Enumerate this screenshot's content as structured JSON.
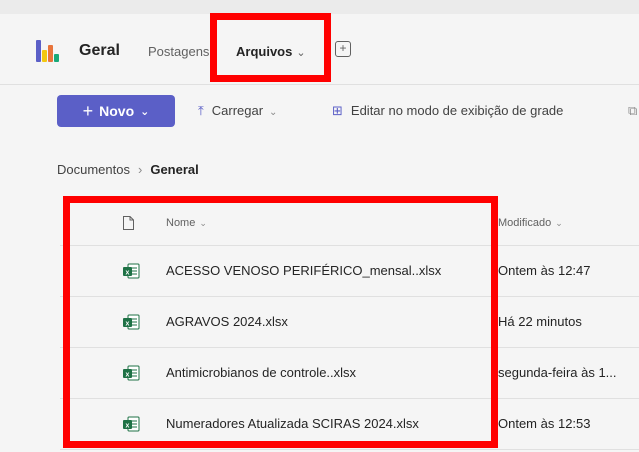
{
  "header": {
    "channel_title": "Geral",
    "tabs": [
      {
        "label": "Postagens"
      },
      {
        "label": "Arquivos"
      }
    ]
  },
  "toolbar": {
    "new_label": "Novo",
    "upload_label": "Carregar",
    "grid_label": "Editar no modo de exibição de grade"
  },
  "breadcrumb": {
    "root": "Documentos",
    "current": "General"
  },
  "table": {
    "columns": {
      "name": "Nome",
      "modified": "Modificado"
    },
    "rows": [
      {
        "name": "ACESSO VENOSO PERIFÉRICO_mensal..xlsx",
        "modified": "Ontem às 12:47"
      },
      {
        "name": "AGRAVOS 2024.xlsx",
        "modified": "Há 22 minutos"
      },
      {
        "name": "Antimicrobianos de controle..xlsx",
        "modified": "segunda-feira às 1..."
      },
      {
        "name": "Numeradores Atualizada SCIRAS 2024.xlsx",
        "modified": "Ontem às 12:53"
      }
    ]
  },
  "colors": {
    "accent": "#5b5fc7",
    "highlight": "#ff0000",
    "excel_green": "#1e7145"
  },
  "icons": [
    "app-logo-icon",
    "chevron-down-icon",
    "add-icon",
    "plus-icon",
    "upload-icon",
    "grid-icon",
    "file-icon",
    "excel-file-icon"
  ]
}
